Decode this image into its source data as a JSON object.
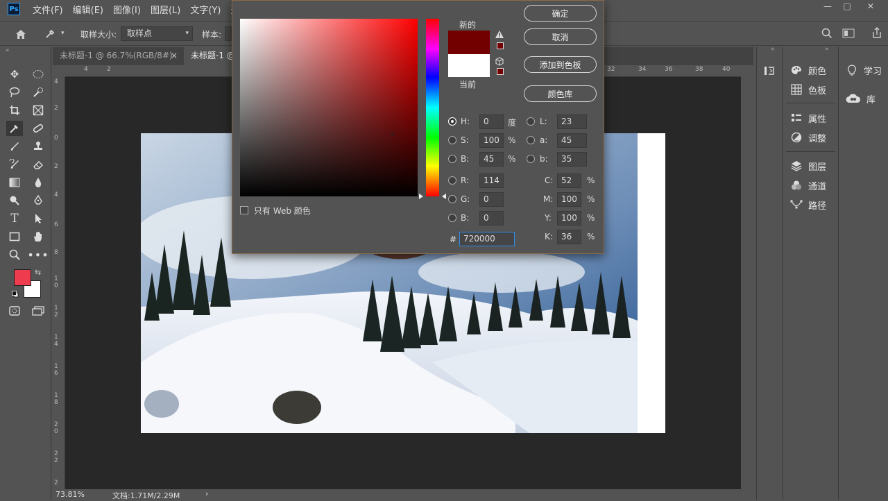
{
  "menubar": {
    "logo": "Ps",
    "items": [
      "文件(F)",
      "编辑(E)",
      "图像(I)",
      "图层(L)",
      "文字(Y)",
      "选择"
    ],
    "win_minimize": "—",
    "win_restore": "□",
    "win_close": "✕"
  },
  "options": {
    "sample_size_label": "取样大小:",
    "sample_size_value": "取样点",
    "sample_label": "样本:"
  },
  "tabs": [
    {
      "label": "未标题-1 @ 66.7%(RGB/8#)",
      "close": "×"
    },
    {
      "label": "未标题-1 @"
    }
  ],
  "ruler_top": [
    "4",
    "2",
    "32",
    "34",
    "36",
    "38",
    "40"
  ],
  "ruler_left": [
    "4",
    "2",
    "0",
    "2",
    "4",
    "6",
    "8",
    "1 0",
    "1 2",
    "1 4",
    "1 6",
    "1 8",
    "2 0",
    "2 2",
    "2"
  ],
  "status": {
    "zoom": "73.81%",
    "doc": "文档:1.71M/2.29M",
    "arrow": "›"
  },
  "colors": {
    "foreground": "#ee3b4d",
    "background": "#ffffff",
    "new_color": "#720000",
    "current_color": "#ffffff"
  },
  "panel_a": [
    {
      "label": "颜色",
      "icon": "palette-icon"
    },
    {
      "label": "色板",
      "icon": "grid-icon"
    },
    {
      "label": "属性",
      "icon": "properties-icon"
    },
    {
      "label": "调整",
      "icon": "adjust-icon"
    },
    {
      "label": "图层",
      "icon": "layers-icon"
    },
    {
      "label": "通道",
      "icon": "channels-icon"
    },
    {
      "label": "路径",
      "icon": "paths-icon"
    }
  ],
  "panel_b": [
    {
      "label": "学习",
      "icon": "bulb-icon"
    },
    {
      "label": "库",
      "icon": "cloud-icon"
    }
  ],
  "picker": {
    "new_label": "新的",
    "current_label": "当前",
    "ok": "确定",
    "cancel": "取消",
    "add_swatch": "添加到色板",
    "color_library": "颜色库",
    "web_only": "只有 Web 颜色",
    "hsb": {
      "h": "0",
      "s": "100",
      "b": "45"
    },
    "rgb": {
      "r": "114",
      "g": "0",
      "b": "0"
    },
    "lab": {
      "l": "23",
      "a": "45",
      "b": "35"
    },
    "cmyk": {
      "c": "52",
      "m": "100",
      "y": "100",
      "k": "36"
    },
    "hex": "720000",
    "labels": {
      "h": "H:",
      "s": "S:",
      "bb": "B:",
      "r": "R:",
      "g": "G:",
      "b2": "B:",
      "l": "L:",
      "a": "a:",
      "b3": "b:",
      "c": "C:",
      "m": "M:",
      "y": "Y:",
      "k": "K:",
      "hash": "#"
    },
    "units": {
      "deg": "度",
      "pct": "%"
    }
  }
}
